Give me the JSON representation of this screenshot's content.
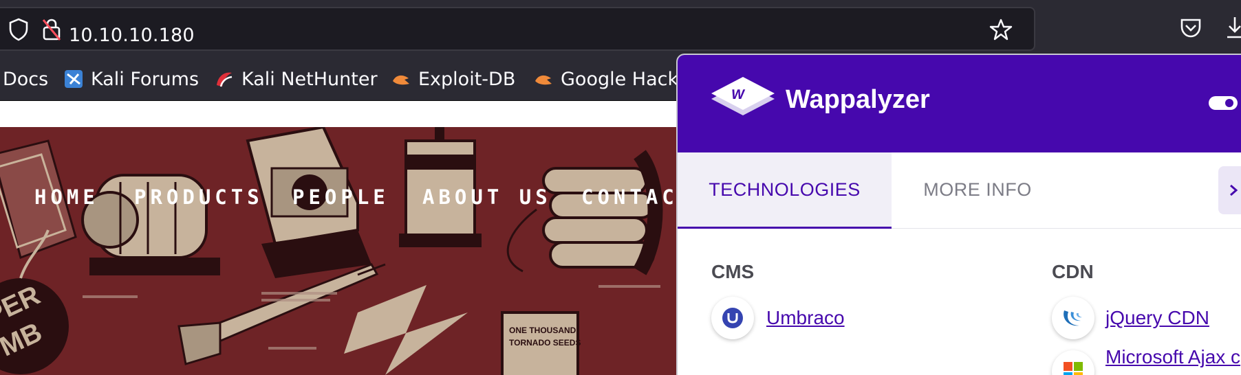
{
  "browser": {
    "url": "10.10.10.180",
    "bookmarks": [
      {
        "label": "Docs"
      },
      {
        "label": "Kali Forums"
      },
      {
        "label": "Kali NetHunter"
      },
      {
        "label": "Exploit-DB"
      },
      {
        "label": "Google Hack"
      }
    ]
  },
  "site": {
    "nav": [
      "HOME",
      "PRODUCTS",
      "PEOPLE",
      "ABOUT US",
      "CONTACT"
    ]
  },
  "wappalyzer": {
    "brand": "Wappalyzer",
    "tabs": {
      "technologies": "TECHNOLOGIES",
      "more_info": "MORE INFO"
    },
    "categories": [
      {
        "name": "CMS",
        "technologies": [
          {
            "name": "Umbraco",
            "icon": "umbraco-icon"
          }
        ]
      },
      {
        "name": "CDN",
        "technologies": [
          {
            "name": "jQuery CDN",
            "icon": "jquery-icon"
          },
          {
            "name": "Microsoft Ajax c",
            "icon": "microsoft-icon"
          }
        ]
      }
    ]
  },
  "colors": {
    "wappalyzer_purple": "#4608ad",
    "annotation_red": "#e03b24",
    "hero_red": "#6e2326"
  }
}
